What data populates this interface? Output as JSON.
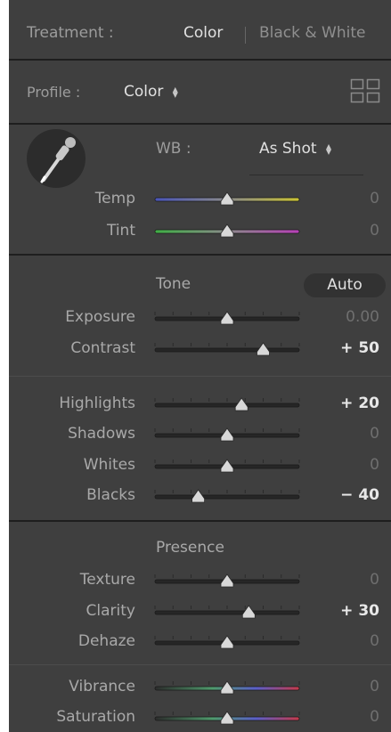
{
  "treatment": {
    "label": "Treatment :",
    "options": [
      "Color",
      "Black & White"
    ],
    "selected": "Color"
  },
  "profile": {
    "label": "Profile :",
    "value": "Color",
    "browser_icon": "grid-icon"
  },
  "wb": {
    "picker_icon": "eyedropper-icon",
    "label": "WB :",
    "value": "As Shot"
  },
  "tone": {
    "title": "Tone",
    "auto_label": "Auto"
  },
  "presence": {
    "title": "Presence"
  },
  "colors": {
    "panel_bg": "#3f3f3f",
    "separator": "#1e1e1e",
    "value_bright": "#e8e8e8",
    "value_dim": "#6f6f6f"
  },
  "sliders": {
    "temp": {
      "label": "Temp",
      "value": "0",
      "position": 0.5
    },
    "tint": {
      "label": "Tint",
      "value": "0",
      "position": 0.5
    },
    "exposure": {
      "label": "Exposure",
      "value": "0.00",
      "position": 0.5
    },
    "contrast": {
      "label": "Contrast",
      "value": "+ 50",
      "position": 0.75
    },
    "highlights": {
      "label": "Highlights",
      "value": "+ 20",
      "position": 0.6
    },
    "shadows": {
      "label": "Shadows",
      "value": "0",
      "position": 0.5
    },
    "whites": {
      "label": "Whites",
      "value": "0",
      "position": 0.5
    },
    "blacks": {
      "label": "Blacks",
      "value": "− 40",
      "position": 0.3
    },
    "texture": {
      "label": "Texture",
      "value": "0",
      "position": 0.5
    },
    "clarity": {
      "label": "Clarity",
      "value": "+ 30",
      "position": 0.65
    },
    "dehaze": {
      "label": "Dehaze",
      "value": "0",
      "position": 0.5
    },
    "vibrance": {
      "label": "Vibrance",
      "value": "0",
      "position": 0.5
    },
    "saturation": {
      "label": "Saturation",
      "value": "0",
      "position": 0.5
    }
  }
}
